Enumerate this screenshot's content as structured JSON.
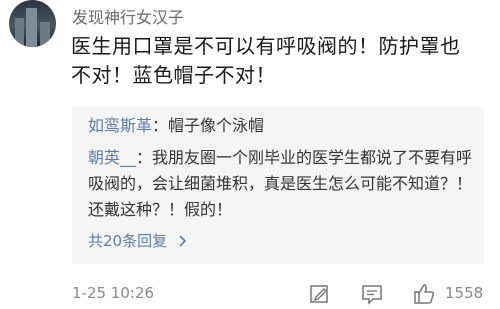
{
  "post": {
    "username": "发现神行女汉子",
    "comment_line1": "医生用口罩是不可以有呼吸阀的！防护罩也",
    "comment_line2": "不对！蓝色帽子不对！"
  },
  "replies": [
    {
      "author": "如鸾斯革",
      "text": "：帽子像个泳帽"
    },
    {
      "author": "朝英__",
      "text": "：我朋友圈一个刚毕业的医学生都说了不要有呼吸阀的，会让细菌堆积，真是医生怎么可能不知道？！还戴这种？！假的！"
    }
  ],
  "more_replies": "共20条回复",
  "more_icon": "chevron-right-icon",
  "footer": {
    "time": "1-25 10:26",
    "likes": "1558",
    "icons": [
      "edit-icon",
      "comment-icon",
      "thumbs-up-icon"
    ]
  },
  "colors": {
    "link": "#5b7fb0",
    "reply_bg": "#f5f5f5",
    "meta": "#8a8a8a"
  }
}
